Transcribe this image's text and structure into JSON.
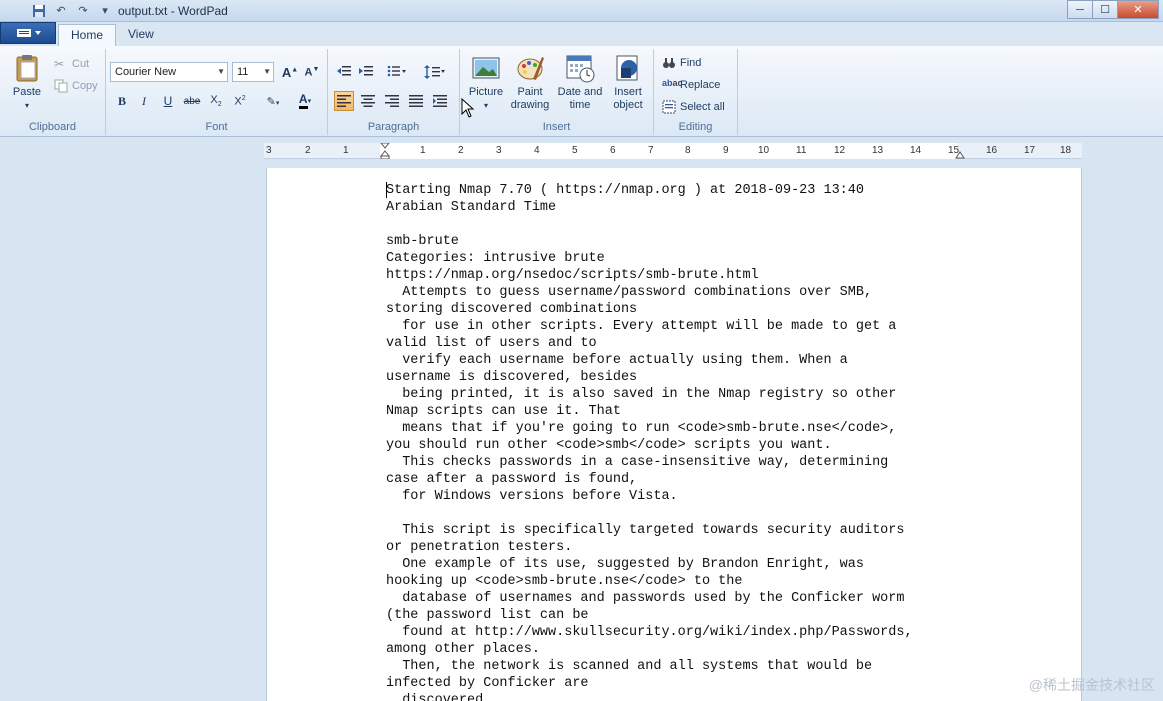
{
  "window": {
    "title": "output.txt - WordPad",
    "minimize_icon": "minimize-icon",
    "maximize_icon": "maximize-icon",
    "close_icon": "close-icon"
  },
  "tabs": [
    {
      "label": "Home",
      "active": true
    },
    {
      "label": "View",
      "active": false
    }
  ],
  "ribbon": {
    "clipboard": {
      "label": "Clipboard",
      "paste": "Paste",
      "cut": "Cut",
      "copy": "Copy"
    },
    "font": {
      "label": "Font",
      "family": "Courier New",
      "size": "11"
    },
    "paragraph": {
      "label": "Paragraph"
    },
    "insert": {
      "label": "Insert",
      "picture": "Picture",
      "paint": "Paint drawing",
      "paint_line1": "Paint",
      "paint_line2": "drawing",
      "datetime_line1": "Date and",
      "datetime_line2": "time",
      "object_line1": "Insert",
      "object_line2": "object"
    },
    "editing": {
      "label": "Editing",
      "find": "Find",
      "replace": "Replace",
      "select_all": "Select all"
    }
  },
  "ruler": {
    "labels": [
      "3",
      "2",
      "1",
      "1",
      "2",
      "3",
      "4",
      "5",
      "6",
      "7",
      "8",
      "9",
      "10",
      "11",
      "12",
      "13",
      "14",
      "15",
      "16",
      "17",
      "18"
    ]
  },
  "document": {
    "lines": [
      "Starting Nmap 7.70 ( https://nmap.org ) at 2018-09-23 13:40",
      "Arabian Standard Time",
      "",
      "smb-brute",
      "Categories: intrusive brute",
      "https://nmap.org/nsedoc/scripts/smb-brute.html",
      "  Attempts to guess username/password combinations over SMB,",
      "storing discovered combinations",
      "  for use in other scripts. Every attempt will be made to get a",
      "valid list of users and to",
      "  verify each username before actually using them. When a",
      "username is discovered, besides",
      "  being printed, it is also saved in the Nmap registry so other",
      "Nmap scripts can use it. That",
      "  means that if you're going to run <code>smb-brute.nse</code>,",
      "you should run other <code>smb</code> scripts you want.",
      "  This checks passwords in a case-insensitive way, determining",
      "case after a password is found,",
      "  for Windows versions before Vista.",
      "",
      "  This script is specifically targeted towards security auditors",
      "or penetration testers.",
      "  One example of its use, suggested by Brandon Enright, was",
      "hooking up <code>smb-brute.nse</code> to the",
      "  database of usernames and passwords used by the Conficker worm",
      "(the password list can be",
      "  found at http://www.skullsecurity.org/wiki/index.php/Passwords,",
      "among other places.",
      "  Then, the network is scanned and all systems that would be",
      "infected by Conficker are",
      "  discovered"
    ]
  },
  "watermark": "@稀土掘金技术社区",
  "colors": {
    "ribbon_bg": "#dce8f5",
    "selected_button": "#f4b75e",
    "workspace": "#d7e4f2"
  }
}
